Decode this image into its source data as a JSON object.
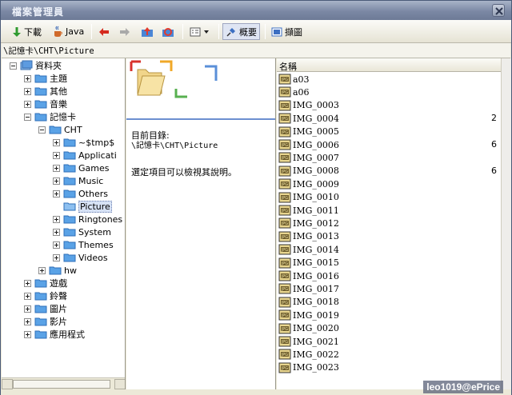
{
  "window": {
    "title": "檔案管理員"
  },
  "toolbar": {
    "download_label": "下載",
    "java_label": "Java",
    "overview_label": "概要",
    "thumbnail_label": "擷圖"
  },
  "path": "\\記憶卡\\CHT\\Picture",
  "tree": {
    "root": "資料夾",
    "items": [
      {
        "label": "主題"
      },
      {
        "label": "其他"
      },
      {
        "label": "音樂"
      },
      {
        "label": "記憶卡"
      },
      {
        "label": "CHT"
      },
      {
        "label": "~$tmp$"
      },
      {
        "label": "Applicati"
      },
      {
        "label": "Games"
      },
      {
        "label": "Music"
      },
      {
        "label": "Others"
      },
      {
        "label": "Picture"
      },
      {
        "label": "Ringtones"
      },
      {
        "label": "System"
      },
      {
        "label": "Themes"
      },
      {
        "label": "Videos"
      },
      {
        "label": "hw"
      },
      {
        "label": "遊戲"
      },
      {
        "label": "鈴聲"
      },
      {
        "label": "圖片"
      },
      {
        "label": "影片"
      },
      {
        "label": "應用程式"
      }
    ]
  },
  "description": {
    "dir_label": "目前目錄:",
    "dir_value": "\\記憶卡\\CHT\\Picture",
    "hint": "選定項目可以檢視其說明。"
  },
  "file_list": {
    "header": "名稱",
    "files": [
      {
        "name": "a03",
        "size_clip": ""
      },
      {
        "name": "a06",
        "size_clip": ""
      },
      {
        "name": "IMG_0003",
        "size_clip": ""
      },
      {
        "name": "IMG_0004",
        "size_clip": "2"
      },
      {
        "name": "IMG_0005",
        "size_clip": ""
      },
      {
        "name": "IMG_0006",
        "size_clip": "6"
      },
      {
        "name": "IMG_0007",
        "size_clip": ""
      },
      {
        "name": "IMG_0008",
        "size_clip": "6"
      },
      {
        "name": "IMG_0009",
        "size_clip": ""
      },
      {
        "name": "IMG_0010",
        "size_clip": ""
      },
      {
        "name": "IMG_0011",
        "size_clip": ""
      },
      {
        "name": "IMG_0012",
        "size_clip": ""
      },
      {
        "name": "IMG_0013",
        "size_clip": ""
      },
      {
        "name": "IMG_0014",
        "size_clip": ""
      },
      {
        "name": "IMG_0015",
        "size_clip": ""
      },
      {
        "name": "IMG_0016",
        "size_clip": ""
      },
      {
        "name": "IMG_0017",
        "size_clip": ""
      },
      {
        "name": "IMG_0018",
        "size_clip": ""
      },
      {
        "name": "IMG_0019",
        "size_clip": ""
      },
      {
        "name": "IMG_0020",
        "size_clip": ""
      },
      {
        "name": "IMG_0021",
        "size_clip": ""
      },
      {
        "name": "IMG_0022",
        "size_clip": ""
      },
      {
        "name": "IMG_0023",
        "size_clip": ""
      }
    ]
  },
  "watermark": "leo1019@ePrice",
  "colors": {
    "accent": "#6c8fd0",
    "folder": "#3a8fd8"
  }
}
